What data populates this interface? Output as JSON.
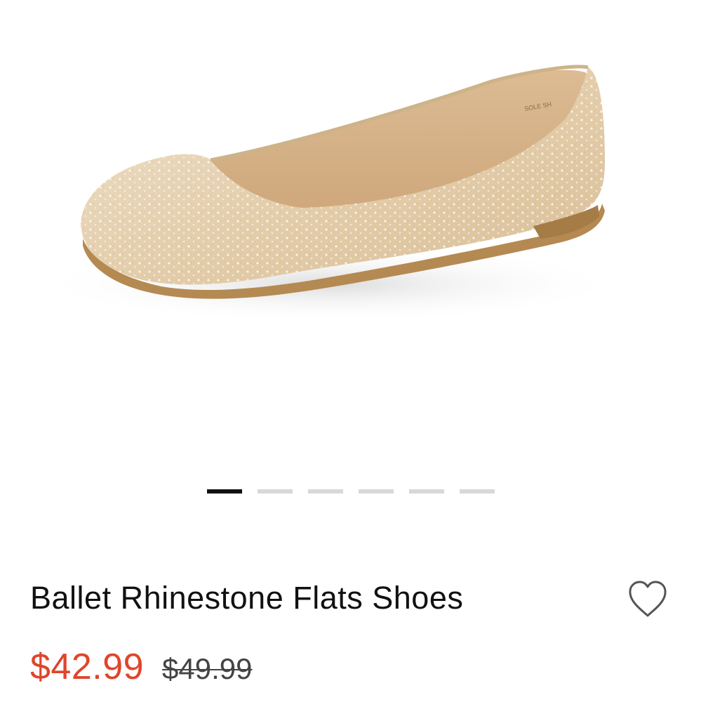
{
  "product": {
    "image": {
      "icon": "ballet-flat-shoe-photo",
      "colors": {
        "upper": "#e4cfae",
        "lining": "#d8b78f",
        "sole": "#b48a52"
      }
    },
    "carousel": {
      "count": 6,
      "active_index": 0,
      "colors": {
        "active": "#111111",
        "inactive": "#d8d8d8"
      }
    },
    "title": "Ballet Rhinestone Flats Shoes",
    "wishlist_icon": "heart-outline-icon",
    "price": {
      "sale": "$42.99",
      "original": "$49.99",
      "sale_color": "#e0452c"
    }
  }
}
